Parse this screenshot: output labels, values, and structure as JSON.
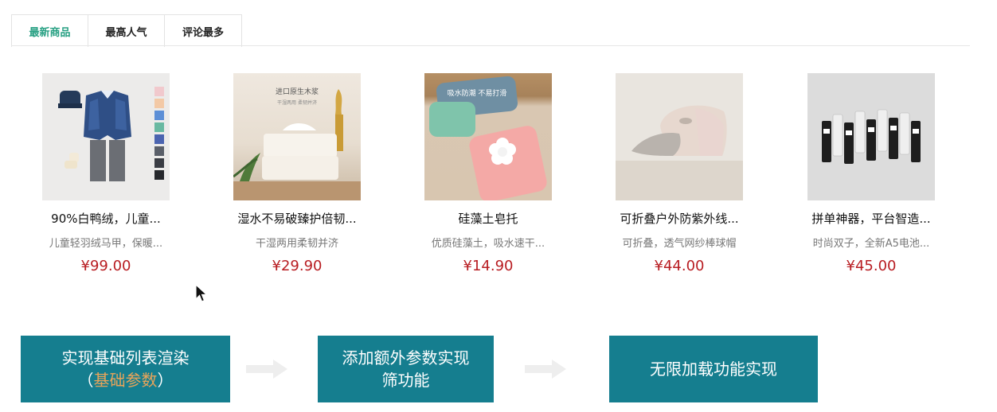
{
  "tabs": [
    {
      "label": "最新商品",
      "active": true
    },
    {
      "label": "最高人气",
      "active": false
    },
    {
      "label": "评论最多",
      "active": false
    }
  ],
  "products": [
    {
      "name": "90%白鸭绒，儿童...",
      "desc": "儿童轻羽绒马甲，保暖...",
      "price": "¥99.00",
      "image": "kids-down-vest"
    },
    {
      "name": "湿水不易破臻护倍韧...",
      "desc": "干湿两用柔韧并济",
      "price": "¥29.90",
      "image": "tissue-pack",
      "image_text": {
        "title": "进口原生木浆",
        "sub": "干湿两用 柔韧并济"
      }
    },
    {
      "name": "硅藻土皂托",
      "desc": "优质硅藻土，吸水速干...",
      "price": "¥14.90",
      "image": "diatomite-soap-dish",
      "image_text": {
        "title": "吸水防潮 不易打滑"
      }
    },
    {
      "name": "可折叠户外防紫外线...",
      "desc": "可折叠，透气网纱棒球帽",
      "price": "¥44.00",
      "image": "foldable-cap"
    },
    {
      "name": "拼单神器，平台智造...",
      "desc": "时尚双子，全新A5电池...",
      "price": "¥45.00",
      "image": "batteries"
    }
  ],
  "flow": [
    {
      "line1": "实现基础列表渲染",
      "line2_prefix": "（",
      "line2_highlight": "基础参数",
      "line2_suffix": "）"
    },
    {
      "line1": "添加额外参数实现",
      "line2": "筛功能"
    },
    {
      "line1": "无限加载功能实现"
    }
  ],
  "colors": {
    "tab_active": "#27a083",
    "price": "#b81d22",
    "flow_box": "#157e8f",
    "highlight": "#e8a45a"
  }
}
